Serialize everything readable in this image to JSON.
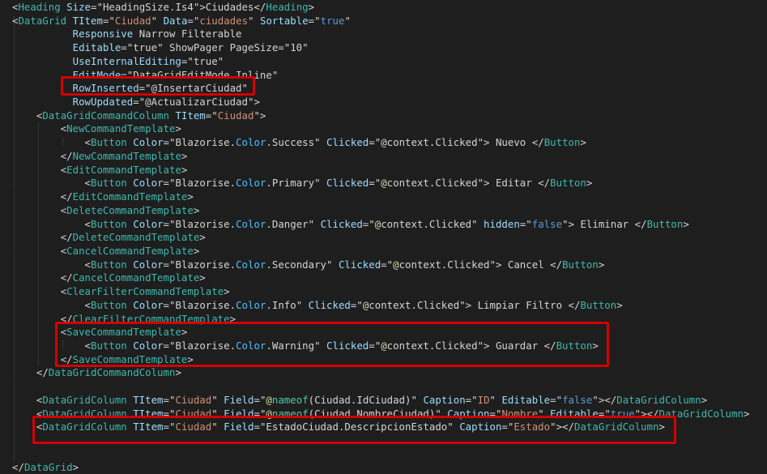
{
  "lines": [
    "<Heading Size=\"HeadingSize.Is4\">Ciudades</Heading>",
    "<DataGrid TItem=\"Ciudad\" Data=\"ciudades\" Sortable=\"true\"",
    "          Responsive Narrow Filterable",
    "          Editable=\"true\" ShowPager PageSize=\"10\"",
    "          UseInternalEditing=\"true\"",
    "          EditMode=\"DataGridEditMode.Inline\"",
    "          RowInserted=\"@InsertarCiudad\"",
    "          RowUpdated=\"@ActualizarCiudad\">",
    "    <DataGridCommandColumn TItem=\"Ciudad\">",
    "        <NewCommandTemplate>",
    "            <Button Color=\"Blazorise.Color.Success\" Clicked=\"@context.Clicked\"> Nuevo </Button>",
    "        </NewCommandTemplate>",
    "        <EditCommandTemplate>",
    "            <Button Color=\"Blazorise.Color.Primary\" Clicked=\"@context.Clicked\"> Editar </Button>",
    "        </EditCommandTemplate>",
    "        <DeleteCommandTemplate>",
    "            <Button Color=\"Blazorise.Color.Danger\" Clicked=\"@context.Clicked\" hidden=\"false\"> Eliminar </Button>",
    "        </DeleteCommandTemplate>",
    "        <CancelCommandTemplate>",
    "            <Button Color=\"Blazorise.Color.Secondary\" Clicked=\"@context.Clicked\"> Cancel </Button>",
    "        </CancelCommandTemplate>",
    "        <ClearFilterCommandTemplate>",
    "            <Button Color=\"Blazorise.Color.Info\" Clicked=\"@context.Clicked\"> Limpiar Filtro </Button>",
    "        </ClearFilterCommandTemplate>",
    "        <SaveCommandTemplate>",
    "            <Button Color=\"Blazorise.Color.Warning\" Clicked=\"@context.Clicked\"> Guardar </Button>",
    "        </SaveCommandTemplate>",
    "    </DataGridCommandColumn>",
    "",
    "    <DataGridColumn TItem=\"Ciudad\" Field=\"@nameof(Ciudad.IdCiudad)\" Caption=\"ID\" Editable=\"false\"></DataGridColumn>",
    "    <DataGridColumn TItem=\"Ciudad\" Field=\"@nameof(Ciudad.NombreCiudad)\" Caption=\"Nombre\" Editable=\"true\"></DataGridColumn>",
    "    <DataGridColumn TItem=\"Ciudad\" Field=\"EstadoCiudad.DescripcionEstado\" Caption=\"Estado\"></DataGridColumn>",
    "",
    "",
    "</DataGrid>"
  ],
  "colors": {
    "background": "#1e1e1e",
    "highlight_box": "#d40000"
  }
}
